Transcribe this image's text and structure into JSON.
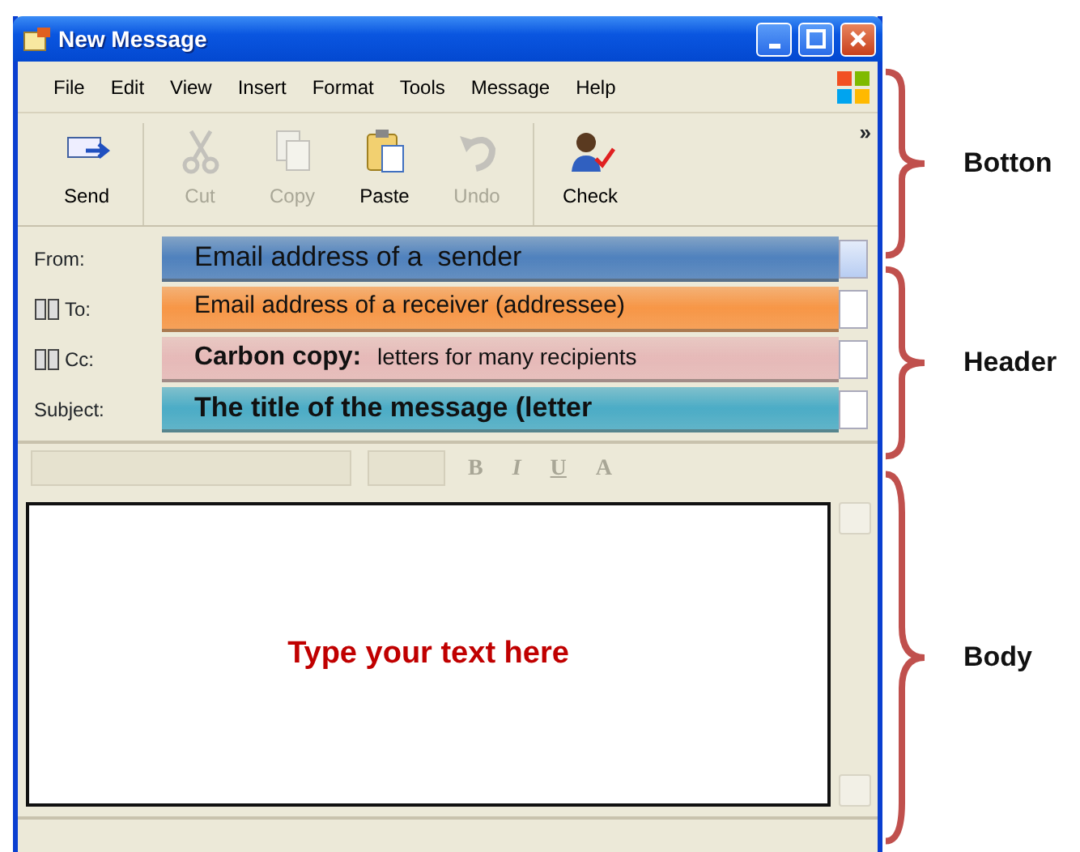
{
  "window": {
    "title": "New Message"
  },
  "menu": [
    "File",
    "Edit",
    "View",
    "Insert",
    "Format",
    "Tools",
    "Message",
    "Help"
  ],
  "toolbar": [
    {
      "label": "Send",
      "kind": "send",
      "disabled": false
    },
    {
      "label": "Cut",
      "kind": "cut",
      "disabled": true
    },
    {
      "label": "Copy",
      "kind": "copy",
      "disabled": true
    },
    {
      "label": "Paste",
      "kind": "paste",
      "disabled": false
    },
    {
      "label": "Undo",
      "kind": "undo",
      "disabled": true
    },
    {
      "label": "Check",
      "kind": "check",
      "disabled": false
    }
  ],
  "toolbar_overflow": "»",
  "fields": [
    {
      "label": "From:",
      "kind": "dropdown",
      "annotation": "Email address of a  sender",
      "color": "#4f81bd"
    },
    {
      "label": "To:",
      "kind": "address",
      "annotation": "Email address of a receiver (addressee)",
      "color": "#f79646"
    },
    {
      "label": "Cc:",
      "kind": "address",
      "annotation": "**Carbon copy:** letters for many recipients",
      "color": "#e6b9b8"
    },
    {
      "label": "Subject:",
      "kind": "text",
      "annotation": "The title of the message (letter",
      "color": "#4bacc6"
    }
  ],
  "format_buttons": [
    "B",
    "I",
    "U",
    "A"
  ],
  "body": {
    "annotation": "Type your text here"
  },
  "brackets": [
    {
      "label": "Botton"
    },
    {
      "label": "Header"
    },
    {
      "label": "Body"
    }
  ]
}
